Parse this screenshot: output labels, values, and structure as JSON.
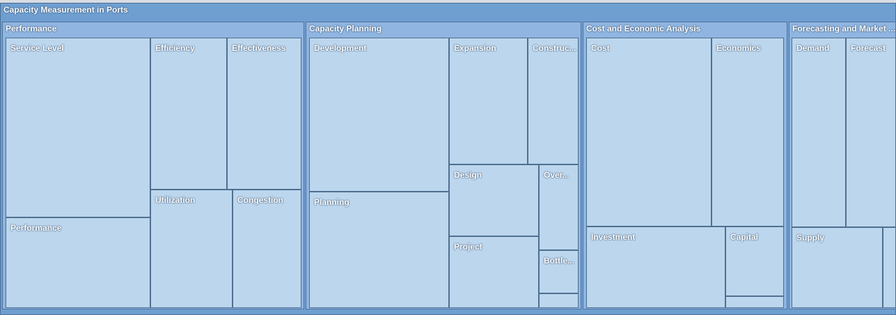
{
  "chart_data": {
    "type": "treemap",
    "title": "Capacity Measurement in Ports",
    "groups": [
      {
        "name": "Performance",
        "items": [
          {
            "label": "Service Level"
          },
          {
            "label": "Efficiency"
          },
          {
            "label": "Effectiveness"
          },
          {
            "label": "Performance"
          },
          {
            "label": "Utilization"
          },
          {
            "label": "Congestion"
          }
        ]
      },
      {
        "name": "Capacity Planning",
        "items": [
          {
            "label": "Development"
          },
          {
            "label": "Expansion"
          },
          {
            "label": "Construc..."
          },
          {
            "label": "Planning"
          },
          {
            "label": "Design"
          },
          {
            "label": "Over..."
          },
          {
            "label": "Project"
          },
          {
            "label": "Bottle..."
          },
          {
            "label": ""
          }
        ]
      },
      {
        "name": "Cost and Economic Analysis",
        "items": [
          {
            "label": "Cost"
          },
          {
            "label": "Economics"
          },
          {
            "label": "Investment"
          },
          {
            "label": "Capital"
          },
          {
            "label": ""
          }
        ]
      },
      {
        "name": "Forecasting and Market ...",
        "items": [
          {
            "label": "Demand"
          },
          {
            "label": "Forecast"
          },
          {
            "label": "Supply"
          },
          {
            "label": ""
          }
        ]
      }
    ],
    "colors": {
      "root": "#6f9fd1",
      "group": "#8fb5e0",
      "tile": "#bcd6ee",
      "border": "#4f6f8f"
    }
  }
}
